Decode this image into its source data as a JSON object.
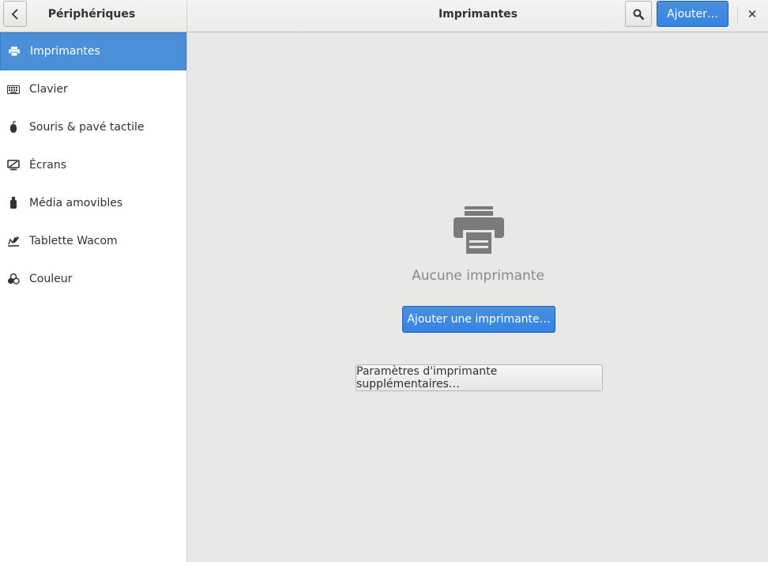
{
  "header": {
    "sidebar_title": "Périphériques",
    "page_title": "Imprimantes",
    "add_label": "Ajouter…",
    "close_glyph": "✕"
  },
  "sidebar": {
    "items": [
      {
        "label": "Imprimantes",
        "icon": "printer-icon",
        "active": true
      },
      {
        "label": "Clavier",
        "icon": "keyboard-icon",
        "active": false
      },
      {
        "label": "Souris & pavé tactile",
        "icon": "mouse-icon",
        "active": false
      },
      {
        "label": "Écrans",
        "icon": "display-icon",
        "active": false
      },
      {
        "label": "Média amovibles",
        "icon": "usb-drive-icon",
        "active": false
      },
      {
        "label": "Tablette Wacom",
        "icon": "tablet-icon",
        "active": false
      },
      {
        "label": "Couleur",
        "icon": "color-icon",
        "active": false
      }
    ]
  },
  "main": {
    "empty_label": "Aucune imprimante",
    "add_printer_label": "Ajouter une imprimante…",
    "extra_settings_label": "Paramètres d'imprimante supplémentaires…"
  },
  "colors": {
    "accent": "#4a90d9",
    "accent_button": "#3584e4",
    "background": "#e8e8e7",
    "sidebar_bg": "#ffffff",
    "muted_text": "#888a85"
  }
}
